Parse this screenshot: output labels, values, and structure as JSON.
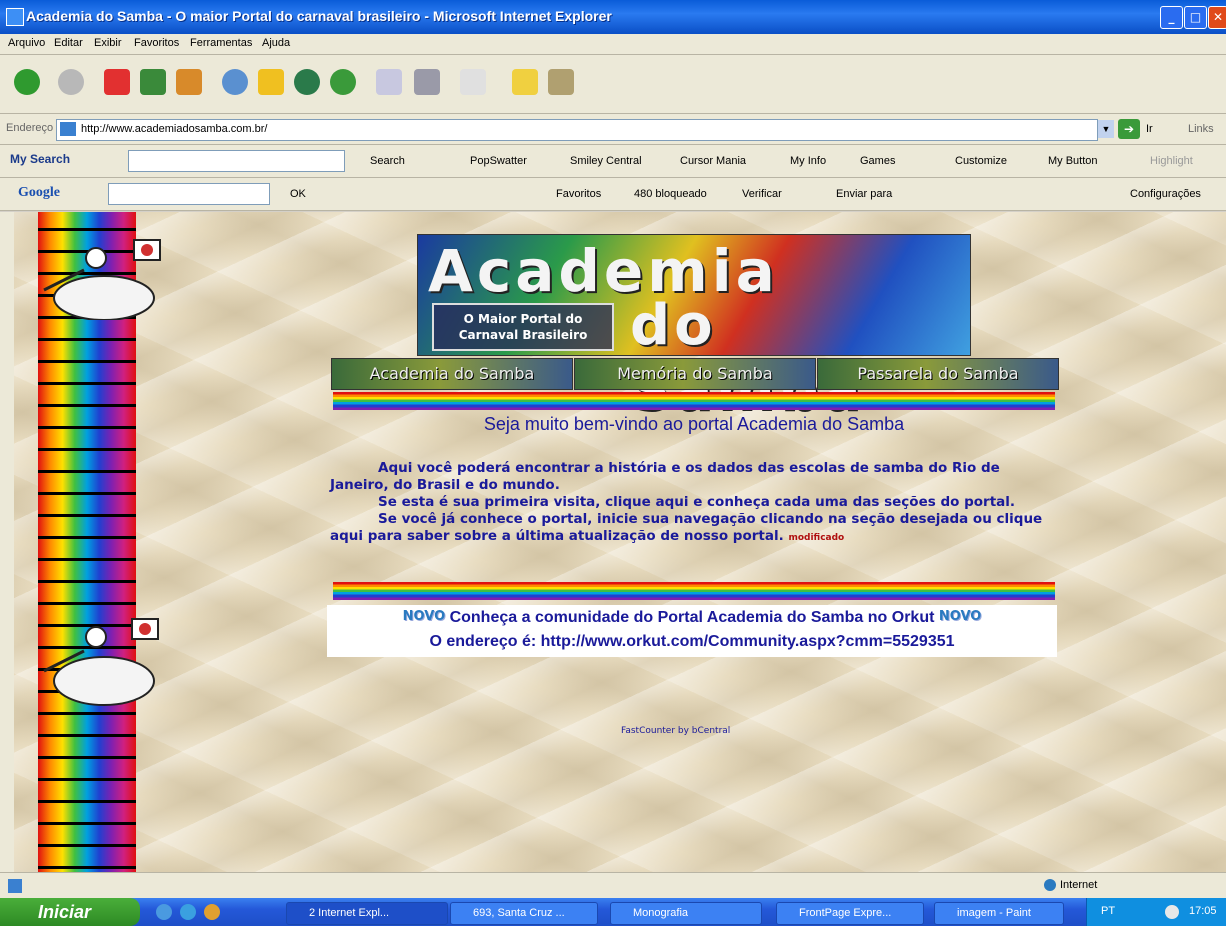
{
  "window": {
    "title": "Academia do Samba - O maior Portal do carnaval brasileiro - Microsoft Internet Explorer",
    "controls": [
      "_",
      "□",
      "✕"
    ]
  },
  "menu": [
    "Arquivo",
    "Editar",
    "Exibir",
    "Favoritos",
    "Ferramentas",
    "Ajuda"
  ],
  "address": {
    "label": "Endereço",
    "url": "http://www.academiadosamba.com.br/",
    "go_label": "Ir",
    "links_label": "Links"
  },
  "searchbar": {
    "brand": "My Search",
    "items": [
      "Search",
      "PopSwatter",
      "Smiley Central",
      "Cursor Mania",
      "My Info",
      "Games",
      "Customize",
      "My Button",
      "Highlight"
    ]
  },
  "googlebar": {
    "brand": "Google",
    "items": [
      "OK",
      "Favoritos",
      "480 bloqueado",
      "Verificar",
      "Enviar para",
      "Configurações"
    ]
  },
  "page": {
    "banner": {
      "title_line1": "Academia",
      "title_line2": "do Samba",
      "subtitle_line1": "O Maior Portal do",
      "subtitle_line2": "Carnaval Brasileiro"
    },
    "nav": [
      "Academia do Samba",
      "Memória do Samba",
      "Passarela do Samba"
    ],
    "welcome": "Seja muito bem-vindo ao portal Academia do Samba",
    "paragraphs": [
      "Aqui você poderá encontrar a história e os dados das escolas de samba do Rio de Janeiro, do Brasil e do mundo.",
      "Se esta é sua primeira visita, clique aqui e conheça cada uma das seções do portal.",
      "Se você já conhece o portal, inicie sua navegação clicando na seção desejada ou clique aqui para saber sobre a última atualização de nosso portal."
    ],
    "modificado": "modificado",
    "novo_badge": "NOVO",
    "orkut_line1": "Conheça a comunidade do Portal Academia do Samba no Orkut",
    "orkut_line2": "O endereço é: http://www.orkut.com/Community.aspx?cmm=5529351",
    "fastcounter": "FastCounter by bCentral"
  },
  "status": {
    "zone": "Internet"
  },
  "taskbar": {
    "start": "Iniciar",
    "tasks": [
      "2 Internet Expl...",
      "693, Santa Cruz ...",
      "Monografia",
      "FrontPage Expre...",
      "imagem - Paint"
    ],
    "lang": "PT",
    "clock": "17:05"
  }
}
